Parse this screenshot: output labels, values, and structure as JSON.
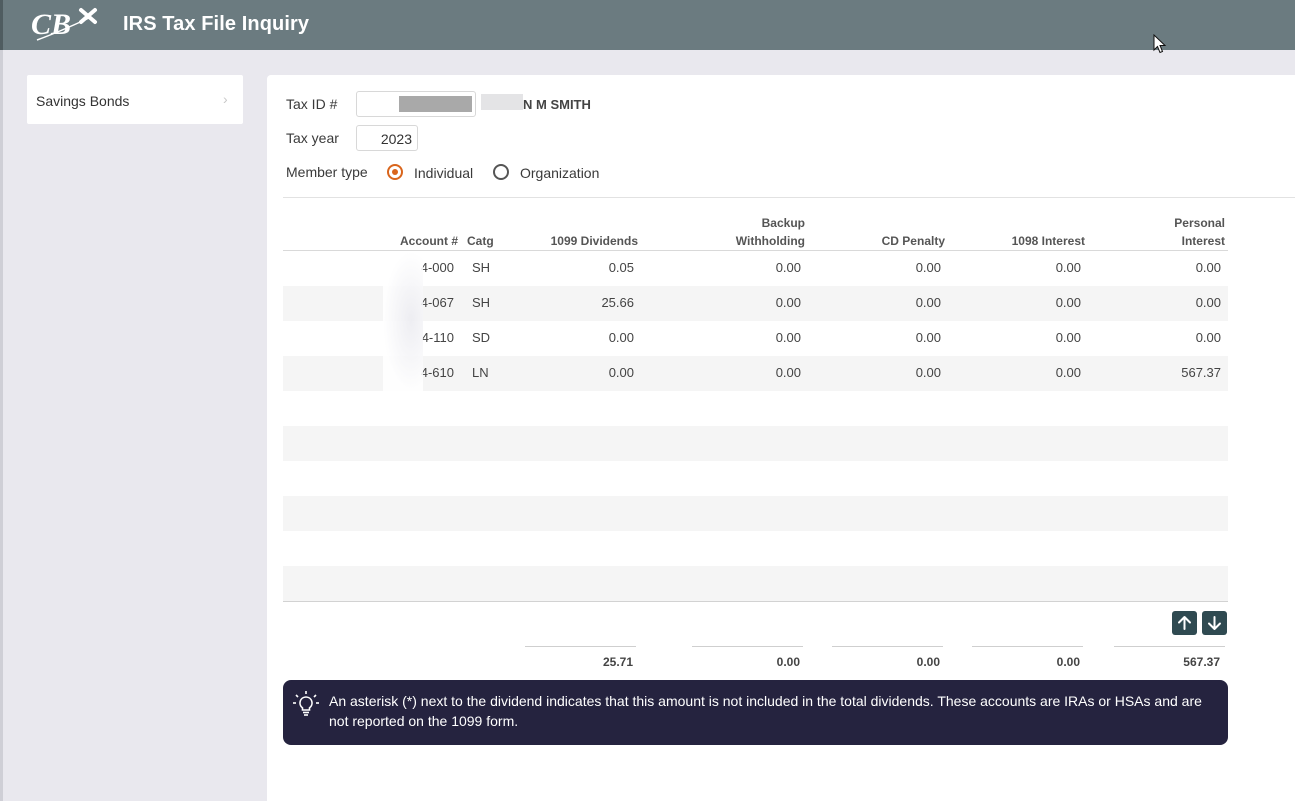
{
  "header": {
    "logo_text": "CBX",
    "title": "IRS Tax File Inquiry"
  },
  "sidebar": {
    "items": [
      {
        "label": "Savings Bonds",
        "icon": "chevron-right-icon"
      }
    ]
  },
  "form": {
    "tax_id_label": "Tax ID #",
    "tax_id_value": "",
    "member_name": "N M SMITH",
    "tax_year_label": "Tax year",
    "tax_year_value": "2023",
    "member_type_label": "Member type",
    "member_types": [
      {
        "label": "Individual",
        "selected": true
      },
      {
        "label": "Organization",
        "selected": false
      }
    ]
  },
  "table": {
    "columns": {
      "account": "Account #",
      "catg": "Catg",
      "dividends": "1099 Dividends",
      "backup_1": "Backup",
      "backup_2": "Withholding",
      "cd_penalty": "CD Penalty",
      "interest_1098": "1098 Interest",
      "personal_1": "Personal",
      "personal_2": "Interest"
    },
    "rows": [
      {
        "account": "4-000",
        "catg": "SH",
        "dividends": "0.05",
        "backup": "0.00",
        "cd_penalty": "0.00",
        "interest_1098": "0.00",
        "personal": "0.00"
      },
      {
        "account": "4-067",
        "catg": "SH",
        "dividends": "25.66",
        "backup": "0.00",
        "cd_penalty": "0.00",
        "interest_1098": "0.00",
        "personal": "0.00"
      },
      {
        "account": "4-110",
        "catg": "SD",
        "dividends": "0.00",
        "backup": "0.00",
        "cd_penalty": "0.00",
        "interest_1098": "0.00",
        "personal": "0.00"
      },
      {
        "account": "4-610",
        "catg": "LN",
        "dividends": "0.00",
        "backup": "0.00",
        "cd_penalty": "0.00",
        "interest_1098": "0.00",
        "personal": "567.37"
      }
    ],
    "totals": {
      "dividends": "25.71",
      "backup": "0.00",
      "cd_penalty": "0.00",
      "interest_1098": "0.00",
      "personal": "567.37"
    }
  },
  "nav": {
    "up_icon": "arrow-up-icon",
    "down_icon": "arrow-down-icon"
  },
  "info": {
    "icon": "lightbulb-icon",
    "text": "An asterisk (*) next to the dividend indicates that this amount is not included in the total dividends. These accounts are IRAs or HSAs and are not reported on the 1099 form."
  },
  "colors": {
    "header_bg": "#6b7b80",
    "accent_orange": "#d9651c",
    "info_bg": "#25233f",
    "nav_btn": "#2f4a51"
  }
}
